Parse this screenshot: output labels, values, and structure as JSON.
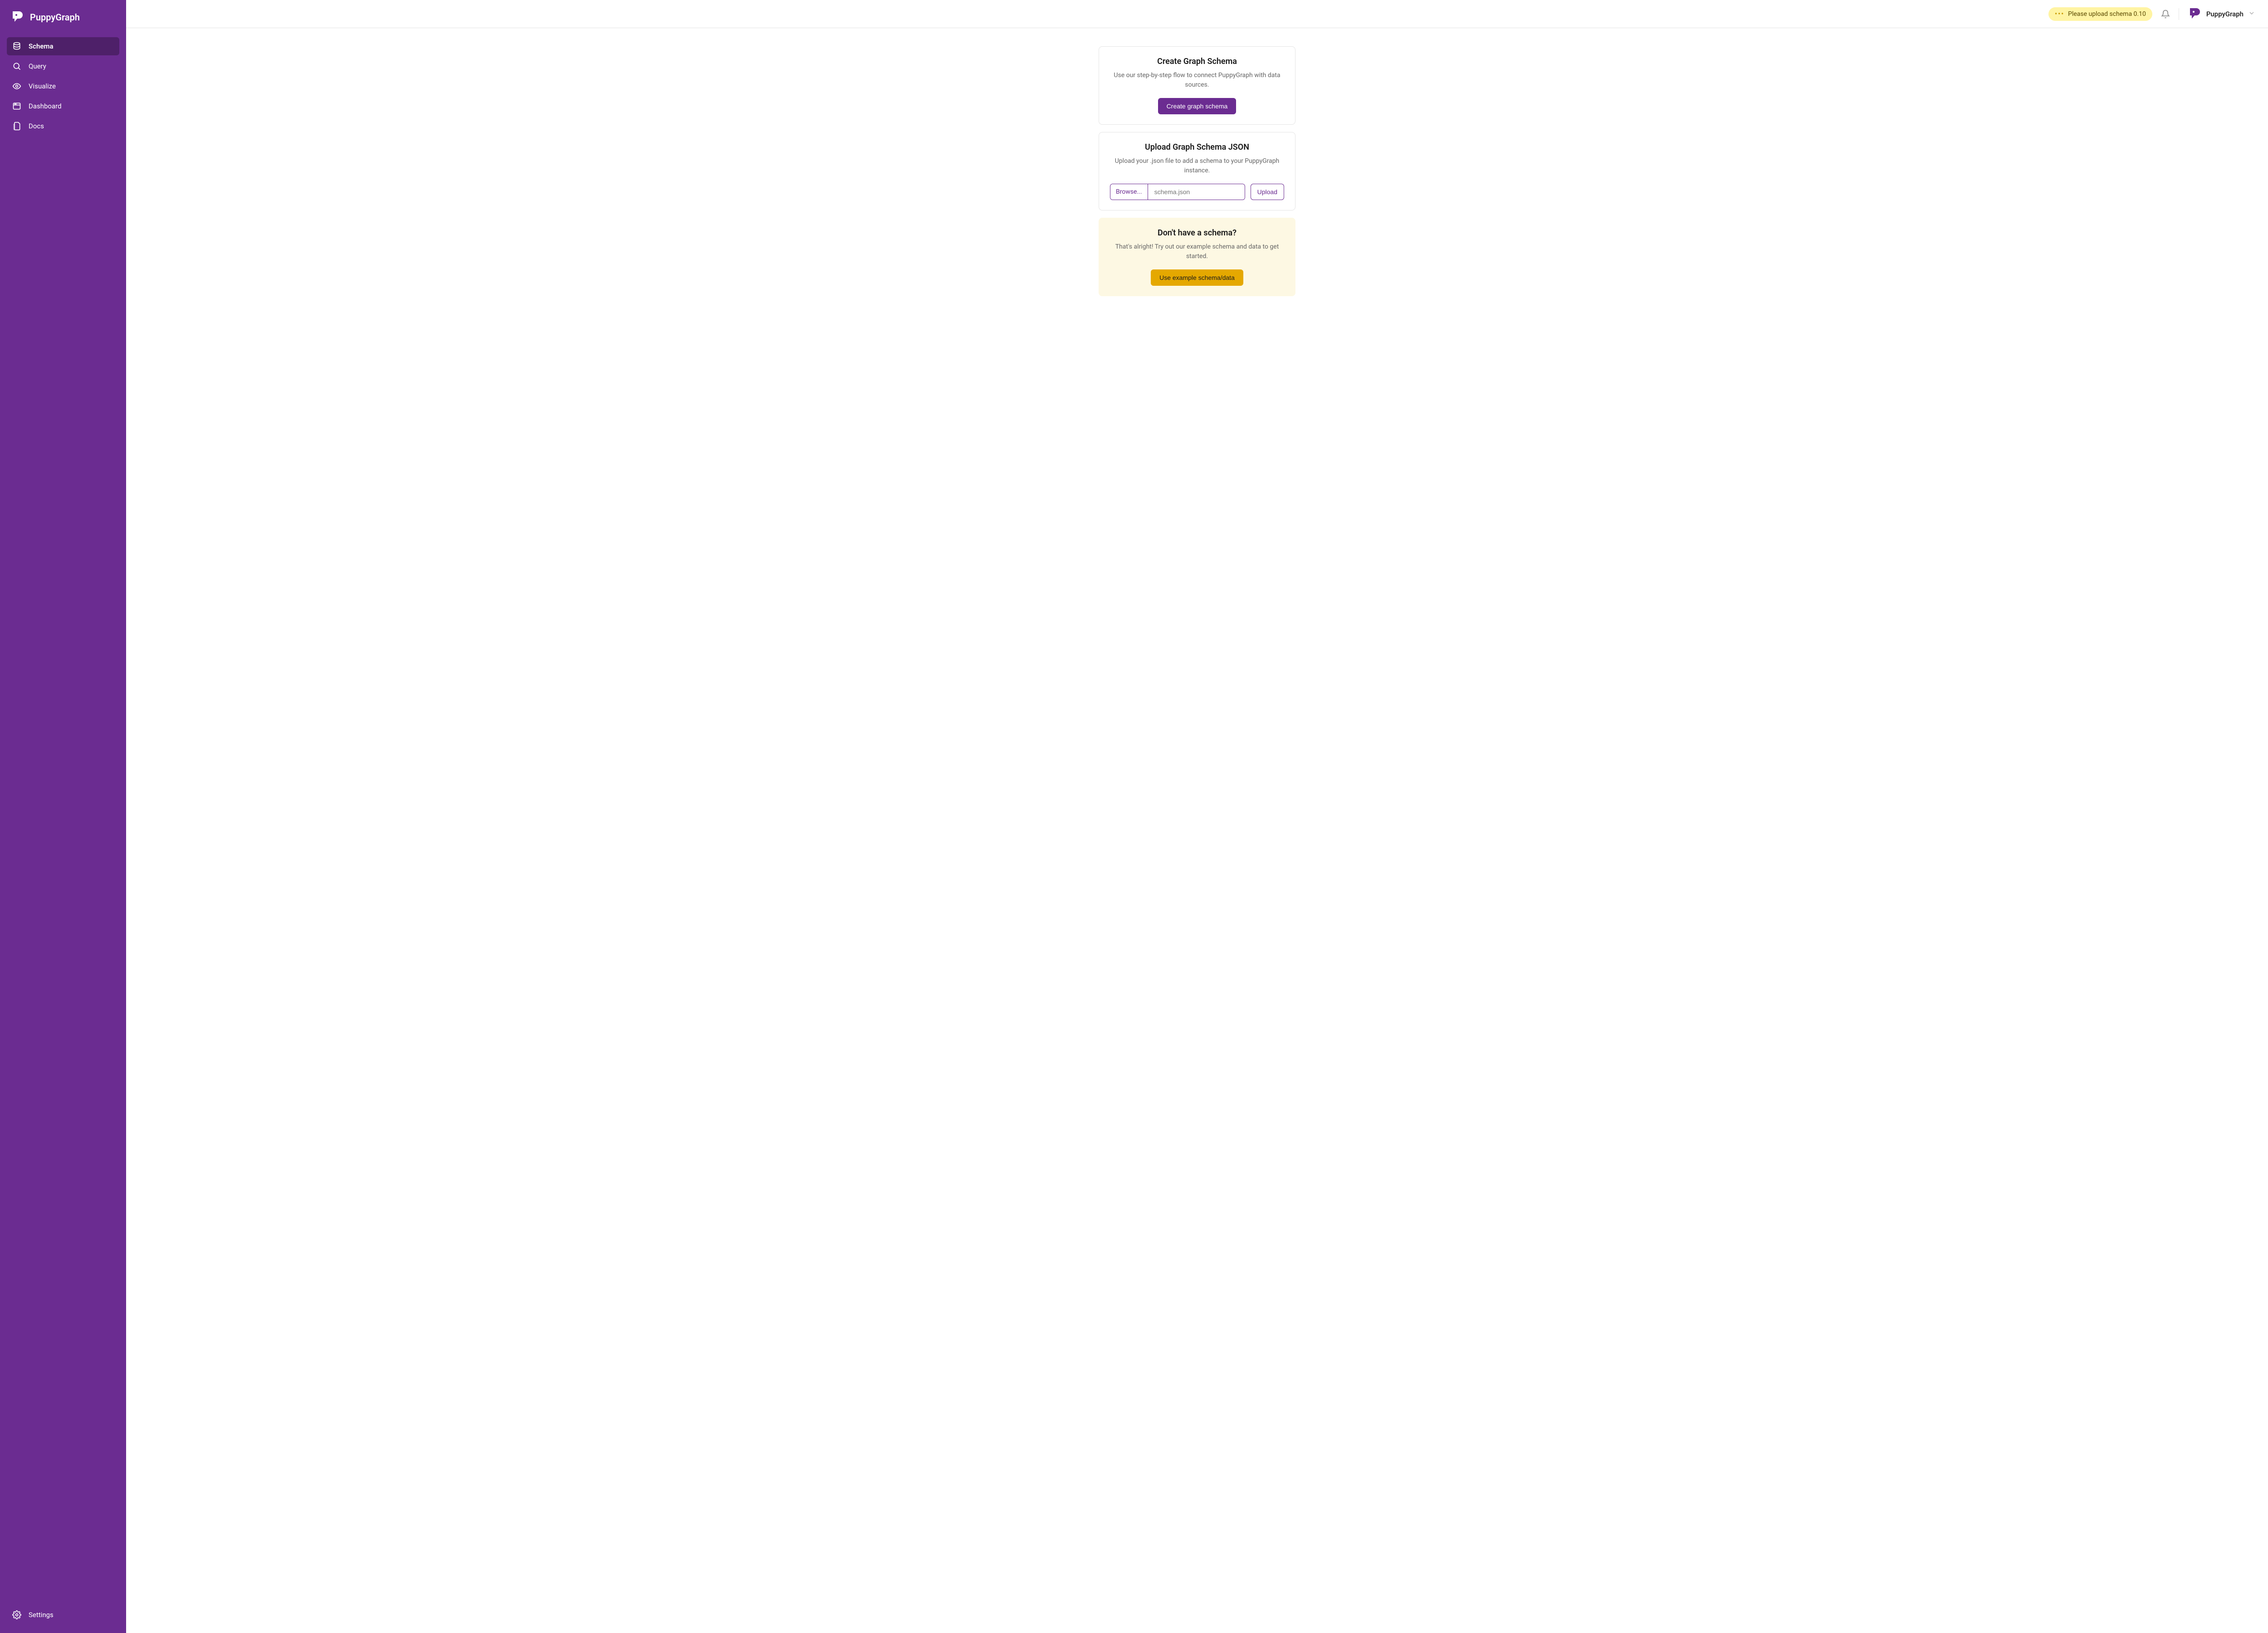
{
  "brand": {
    "name": "PuppyGraph"
  },
  "sidebar": {
    "items": [
      {
        "icon": "database",
        "label": "Schema",
        "active": true
      },
      {
        "icon": "search",
        "label": "Query"
      },
      {
        "icon": "eye",
        "label": "Visualize"
      },
      {
        "icon": "dashboard",
        "label": "Dashboard"
      },
      {
        "icon": "document",
        "label": "Docs"
      }
    ],
    "bottom": {
      "icon": "gear",
      "label": "Settings"
    }
  },
  "topbar": {
    "notice": "Please upload schema 0.10",
    "user_name": "PuppyGraph"
  },
  "cards": {
    "create": {
      "title": "Create Graph Schema",
      "desc": "Use our step-by-step flow to connect PuppyGraph with data sources.",
      "cta": "Create graph schema"
    },
    "upload": {
      "title": "Upload Graph Schema JSON",
      "desc": "Upload your .json file to add a schema to your PuppyGraph instance.",
      "browse": "Browse...",
      "placeholder": "schema.json",
      "cta": "Upload"
    },
    "example": {
      "title": "Don't have a schema?",
      "desc": "That's alright! Try out our example schema and data to get started.",
      "cta": "Use example schema/data"
    }
  }
}
